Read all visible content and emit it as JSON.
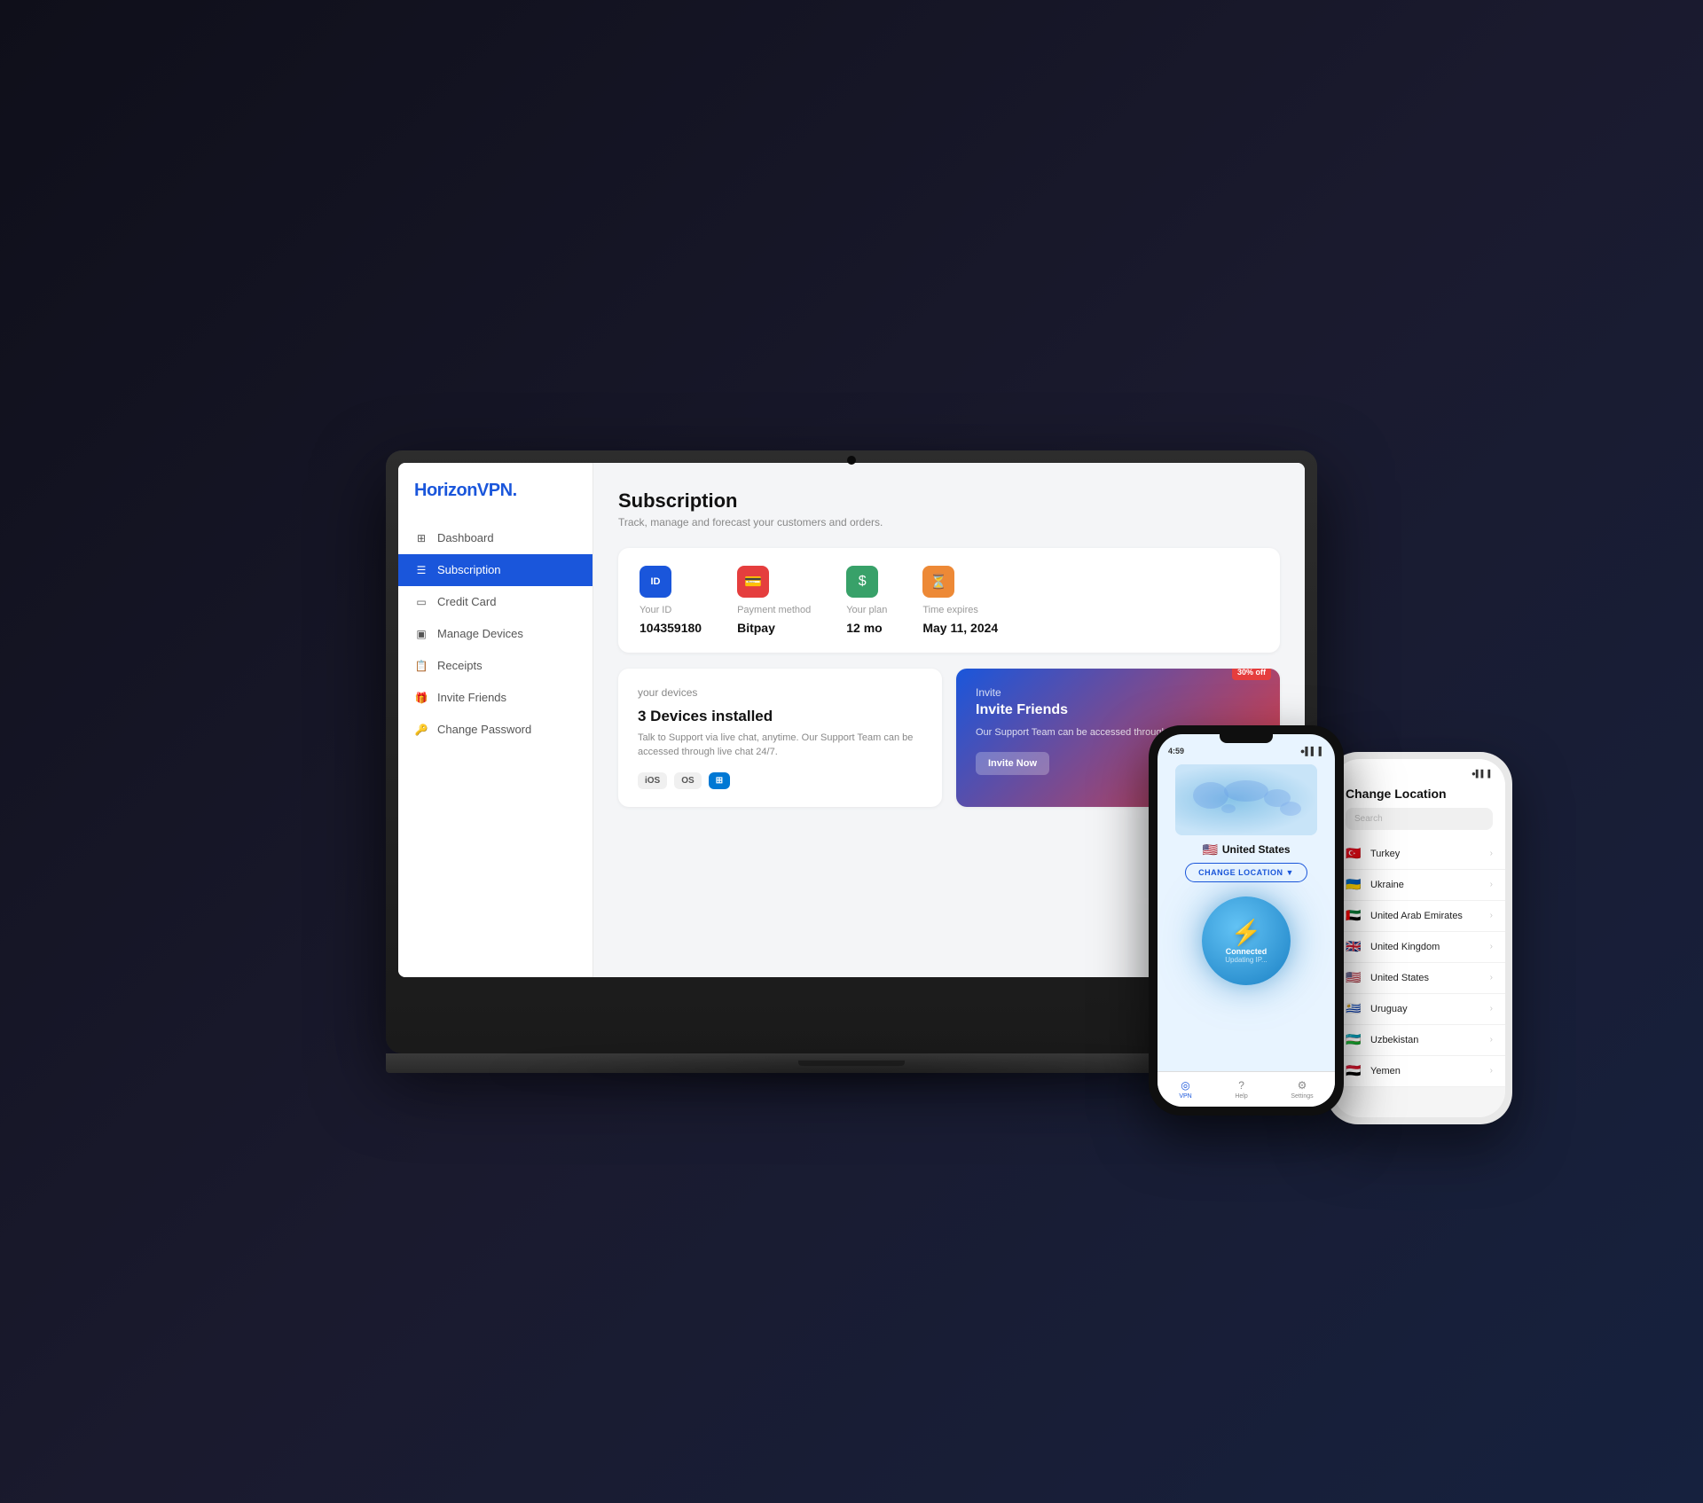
{
  "app": {
    "logo": "HorizonVPN.",
    "logo_accent": "."
  },
  "sidebar": {
    "items": [
      {
        "id": "dashboard",
        "label": "Dashboard",
        "icon": "⊞",
        "active": false
      },
      {
        "id": "subscription",
        "label": "Subscription",
        "icon": "☰",
        "active": true
      },
      {
        "id": "credit-card",
        "label": "Credit Card",
        "icon": "💳",
        "active": false
      },
      {
        "id": "manage-devices",
        "label": "Manage Devices",
        "icon": "🖥",
        "active": false
      },
      {
        "id": "receipts",
        "label": "Receipts",
        "icon": "🗒",
        "active": false
      },
      {
        "id": "invite-friends",
        "label": "Invite Friends",
        "icon": "🎁",
        "active": false
      },
      {
        "id": "change-password",
        "label": "Change Password",
        "icon": "🔑",
        "active": false
      }
    ]
  },
  "main": {
    "title": "Subscription",
    "subtitle": "Track, manage and forecast your customers and orders.",
    "info_card": {
      "items": [
        {
          "id": "your-id",
          "icon": "ID",
          "icon_color": "blue",
          "label": "Your ID",
          "value": "104359180"
        },
        {
          "id": "payment-method",
          "icon": "💳",
          "icon_color": "red",
          "label": "Payment method",
          "value": "Bitpay"
        },
        {
          "id": "your-plan",
          "icon": "$",
          "icon_color": "green",
          "label": "Your plan",
          "value": "12 mo"
        },
        {
          "id": "time-expires",
          "icon": "⏳",
          "icon_color": "orange",
          "label": "Time expires",
          "value": "May 11, 2024"
        }
      ]
    },
    "device_card": {
      "label": "your devices",
      "title": "3 Devices installed",
      "description": "Talk to Support via live chat, anytime. Our Support Team can be accessed through live chat 24/7.",
      "platforms": [
        "iOS",
        "OS",
        "Win"
      ]
    },
    "invite_card": {
      "badge": "30% off",
      "label": "Invite",
      "title": "Invite Friends",
      "description": "Our Support Team can be accessed through live chat.",
      "button_label": "Invite Now"
    }
  },
  "phone1": {
    "status_left": "4:59",
    "status_right": "⬤▌▌ ▌",
    "location": "United States",
    "flag": "🇺🇸",
    "change_location_label": "CHANGE LOCATION ▼",
    "connected_label": "Connected",
    "updating_label": "Updating IP...",
    "nav": [
      {
        "label": "VPN",
        "icon": "◎",
        "active": true
      },
      {
        "label": "Help",
        "icon": "?",
        "active": false
      },
      {
        "label": "Settings",
        "icon": "⚙",
        "active": false
      }
    ]
  },
  "phone2": {
    "header": "Change Location",
    "search_placeholder": "Search",
    "countries": [
      {
        "name": "Turkey",
        "flag": "🇹🇷"
      },
      {
        "name": "Ukraine",
        "flag": "🇺🇦"
      },
      {
        "name": "United Arab Emirates",
        "flag": "🇦🇪"
      },
      {
        "name": "United Kingdom",
        "flag": "🇬🇧"
      },
      {
        "name": "United States",
        "flag": "🇺🇸"
      },
      {
        "name": "Uruguay",
        "flag": "🇺🇾"
      },
      {
        "name": "Uzbekistan",
        "flag": "🇺🇿"
      },
      {
        "name": "Yemen",
        "flag": "🇾🇪"
      }
    ]
  }
}
